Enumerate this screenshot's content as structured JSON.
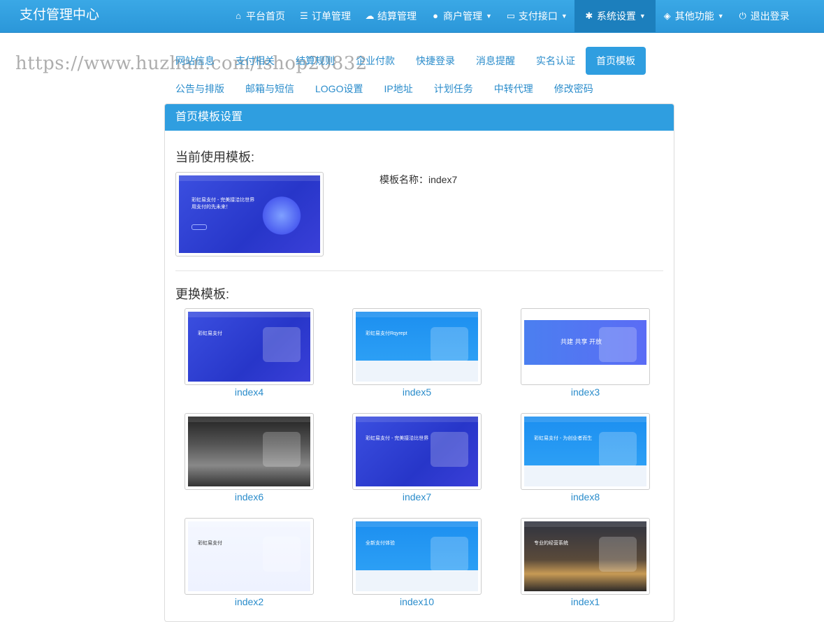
{
  "app": {
    "title": "支付管理中心"
  },
  "nav": {
    "items": [
      {
        "label": "平台首页",
        "icon": "home-icon",
        "glyph": "⌂",
        "dropdown": false,
        "active": false
      },
      {
        "label": "订单管理",
        "icon": "list-icon",
        "glyph": "☰",
        "dropdown": false,
        "active": false
      },
      {
        "label": "结算管理",
        "icon": "cloud-icon",
        "glyph": "☁",
        "dropdown": false,
        "active": false
      },
      {
        "label": "商户管理",
        "icon": "user-icon",
        "glyph": "●",
        "dropdown": true,
        "active": false
      },
      {
        "label": "支付接口",
        "icon": "card-icon",
        "glyph": "▭",
        "dropdown": true,
        "active": false
      },
      {
        "label": "系统设置",
        "icon": "gear-icon",
        "glyph": "✱",
        "dropdown": true,
        "active": true
      },
      {
        "label": "其他功能",
        "icon": "cube-icon",
        "glyph": "◈",
        "dropdown": true,
        "active": false
      },
      {
        "label": "退出登录",
        "icon": "power-icon",
        "glyph": "⏻",
        "dropdown": false,
        "active": false
      }
    ]
  },
  "watermark": "https://www.huzhan.com/ishop20832",
  "subtabs": {
    "row1": [
      "网站信息",
      "支付相关",
      "结算规则",
      "企业付款",
      "快捷登录",
      "消息提醒",
      "实名认证",
      "首页模板"
    ],
    "row2": [
      "公告与排版",
      "邮箱与短信",
      "LOGO设置",
      "IP地址",
      "计划任务",
      "中转代理",
      "修改密码"
    ],
    "active": "首页模板"
  },
  "panel": {
    "title": "首页模板设置",
    "current_heading": "当前使用模板:",
    "current_name": "模板名称：index7",
    "change_heading": "更换模板:"
  },
  "current_thumb": {
    "line1": "彩虹易支付 - 完美接洽比世界",
    "line2": "用支付的先未来！"
  },
  "templates": [
    {
      "name": "index4",
      "style": "blue",
      "caption": "彩虹易支付"
    },
    {
      "name": "index5",
      "style": "sky",
      "caption": "彩虹易支付Rqyrept"
    },
    {
      "name": "index3",
      "style": "white",
      "caption": "共建  共享  开放"
    },
    {
      "name": "index6",
      "style": "dark",
      "caption": ""
    },
    {
      "name": "index7",
      "style": "blue",
      "caption": "彩虹易支付 - 完美接洽比世界"
    },
    {
      "name": "index8",
      "style": "sky",
      "caption": "彩虹易支付 - 为创业者而生"
    },
    {
      "name": "index2",
      "style": "pale",
      "caption": "彩虹易支付"
    },
    {
      "name": "index10",
      "style": "sky2",
      "caption": "全新支付体验"
    },
    {
      "name": "index1",
      "style": "city",
      "caption": "专业的经营系统"
    }
  ]
}
